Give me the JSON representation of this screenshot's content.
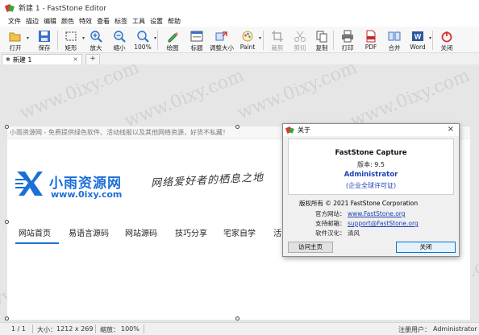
{
  "window": {
    "title": "新建 1 - FastStone Editor"
  },
  "menu": [
    "文件",
    "描边",
    "编辑",
    "颜色",
    "特效",
    "查看",
    "标签",
    "工具",
    "设置",
    "帮助"
  ],
  "toolbar": {
    "open": "打开",
    "save": "保存",
    "rect": "矩形",
    "zoom_in": "放大",
    "zoom_out": "缩小",
    "zoom": "100%",
    "draw": "绘图",
    "caption": "标题",
    "resize": "调整大小",
    "paint": "Paint",
    "crop": "裁剪",
    "cut": "剪切",
    "copy": "复制",
    "print": "打印",
    "pdf": "PDF",
    "merge": "合并",
    "word": "Word",
    "close": "关闭"
  },
  "tabs": {
    "doc": "新建 1",
    "add": "+",
    "close": "×"
  },
  "image": {
    "notice": "小雨资源网 - 免费提供绿色软件、活动线报以及其他网络资源，好货不私藏！",
    "logo_name": "小雨资源网",
    "logo_url": "www.0ixy.com",
    "slogan": "网络爱好者的栖息之地",
    "nav": [
      "网站首页",
      "易语言源码",
      "网站源码",
      "技巧分享",
      "宅家自学",
      "活"
    ]
  },
  "watermark": "www.0ixy.com",
  "status": {
    "page": "1 / 1",
    "size_label": "大小：",
    "size": "1212 x 269",
    "zoom_label": "缩放：",
    "zoom": "100%",
    "reg_label": "注册用户：",
    "reg_user": "Administrator"
  },
  "about": {
    "title": "关于",
    "close": "×",
    "product": "FastStone Capture",
    "version": "版本: 9.5",
    "user": "Administrator",
    "license": "(企业全球许可证)",
    "copyright": "版权所有 © 2021 FastStone Corporation",
    "website_label": "官方网站：",
    "website": "www.FastStone.org",
    "email_label": "支持邮箱：",
    "email": "support@FastStone.org",
    "localize_label": "软件汉化：",
    "localizer": "清风",
    "visit": "访问主页",
    "ok": "关闭"
  },
  "colors": {
    "accent": "#1b6fd6",
    "link": "#1c3fb4",
    "close_red": "#d9302f"
  }
}
